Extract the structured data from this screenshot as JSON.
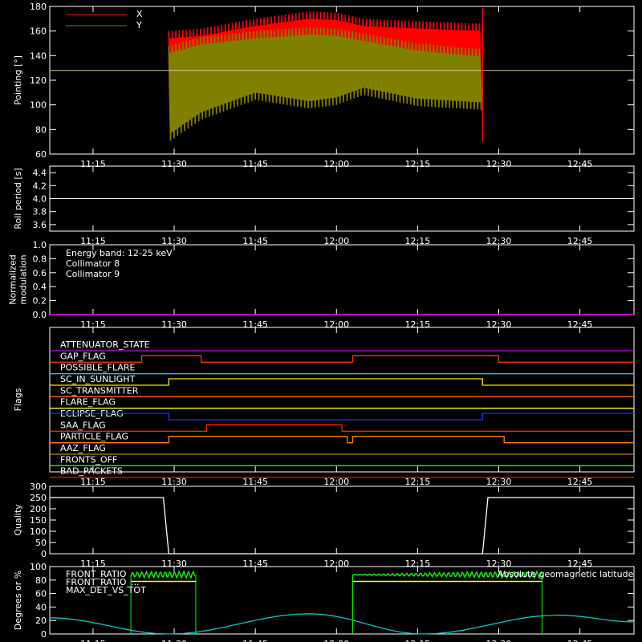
{
  "colors": {
    "background": "#000000",
    "frame": "#ffffff",
    "x_series": "#ff0000",
    "y_series": "#808000",
    "collimator8": "#00ffff",
    "collimator9": "#ff00ff",
    "front_ratio": "#ffff00",
    "front_ratio_2": "#00ff00",
    "max_det": "#ff8000",
    "geomag": "#00c8c8"
  },
  "time_axis": {
    "start": "11:07",
    "end": "12:55",
    "ticks": [
      "11:15",
      "11:30",
      "11:45",
      "12:00",
      "12:15",
      "12:30",
      "12:45"
    ]
  },
  "chart_data": [
    {
      "type": "area",
      "panel": "pointing",
      "ylabel": "Pointing [°]",
      "ylim": [
        60,
        180
      ],
      "yticks": [
        60,
        80,
        100,
        120,
        140,
        160,
        180
      ],
      "reference_line": 128,
      "legend": [
        {
          "name": "X",
          "color": "#ff0000"
        },
        {
          "name": "Y",
          "color": "#808000"
        }
      ],
      "data_start": "11:29",
      "data_end": "12:27",
      "series": [
        {
          "name": "X",
          "x": [
            "11:29",
            "11:35",
            "11:45",
            "11:55",
            "12:00",
            "12:05",
            "12:15",
            "12:27"
          ],
          "upper": [
            160,
            162,
            170,
            176,
            175,
            170,
            168,
            166
          ],
          "lower": [
            75,
            92,
            106,
            98,
            102,
            110,
            100,
            97
          ]
        },
        {
          "name": "Y",
          "x": [
            "11:29",
            "11:35",
            "11:45",
            "11:55",
            "12:00",
            "12:05",
            "12:15",
            "12:27"
          ],
          "upper": [
            148,
            155,
            160,
            163,
            162,
            158,
            150,
            145
          ],
          "lower": [
            70,
            88,
            104,
            97,
            100,
            108,
            99,
            96
          ]
        }
      ]
    },
    {
      "type": "line",
      "panel": "roll_period",
      "ylabel": "Roll period [s]",
      "ylim": [
        3.5,
        4.5
      ],
      "yticks": [
        3.6,
        3.8,
        4.0,
        4.2,
        4.4
      ],
      "value": 4.0
    },
    {
      "type": "line",
      "panel": "modulation",
      "ylabel_lines": [
        "Normalized",
        "modulation"
      ],
      "ylim": [
        0,
        1
      ],
      "yticks": [
        0.0,
        0.2,
        0.4,
        0.6,
        0.8,
        1.0
      ],
      "annotations": [
        {
          "text": "Energy band: 12-25 keV",
          "color": "#ffffff"
        },
        {
          "text": "Collimator 8",
          "color": "#00ffff"
        },
        {
          "text": "Collimator 9",
          "color": "#ff00ff"
        }
      ],
      "value": 0.0
    },
    {
      "type": "line",
      "panel": "flags",
      "ylabel": "Flags",
      "flags": [
        {
          "name": "ATTENUATOR_STATE",
          "color": "#c000ff",
          "segments": [
            [
              "11:07",
              "12:55",
              0
            ]
          ]
        },
        {
          "name": "GAP_FLAG",
          "color": "#ff3000",
          "segments": [
            [
              "11:07",
              "11:24",
              0
            ],
            [
              "11:24",
              "11:35",
              1
            ],
            [
              "11:35",
              "12:03",
              0
            ],
            [
              "12:03",
              "12:30",
              1
            ],
            [
              "12:30",
              "12:55",
              0
            ]
          ]
        },
        {
          "name": "POSSIBLE_FLARE",
          "color": "#00c8ff",
          "segments": [
            [
              "11:07",
              "12:55",
              0
            ]
          ]
        },
        {
          "name": "SC_IN_SUNLIGHT",
          "color": "#ffe000",
          "segments": [
            [
              "11:07",
              "11:29",
              0
            ],
            [
              "11:29",
              "12:27",
              1
            ],
            [
              "12:27",
              "12:55",
              0
            ]
          ]
        },
        {
          "name": "SC_TRANSMITTER",
          "color": "#ff6000",
          "segments": [
            [
              "11:07",
              "12:55",
              0
            ]
          ]
        },
        {
          "name": "FLARE_FLAG",
          "color": "#ffff00",
          "segments": [
            [
              "11:07",
              "12:55",
              0
            ]
          ]
        },
        {
          "name": "ECLIPSE_FLAG",
          "color": "#0040ff",
          "segments": [
            [
              "11:07",
              "11:29",
              1
            ],
            [
              "11:29",
              "12:27",
              0
            ],
            [
              "12:27",
              "12:55",
              1
            ]
          ]
        },
        {
          "name": "SAA_FLAG",
          "color": "#ff2000",
          "segments": [
            [
              "11:07",
              "11:36",
              0
            ],
            [
              "11:36",
              "12:01",
              1
            ],
            [
              "12:01",
              "12:55",
              0
            ]
          ]
        },
        {
          "name": "PARTICLE_FLAG",
          "color": "#ff8000",
          "segments": [
            [
              "11:07",
              "11:29",
              0
            ],
            [
              "11:29",
              "12:02",
              1
            ],
            [
              "12:02",
              "12:03",
              0
            ],
            [
              "12:03",
              "12:31",
              1
            ],
            [
              "12:31",
              "12:55",
              0
            ]
          ]
        },
        {
          "name": "AAZ_FLAG",
          "color": "#c08000",
          "segments": [
            [
              "11:07",
              "12:55",
              0
            ]
          ]
        },
        {
          "name": "FRONTS_OFF",
          "color": "#00ff00",
          "segments": [
            [
              "11:07",
              "12:55",
              0
            ]
          ]
        },
        {
          "name": "BAD_PACKETS",
          "color": "#ff0000",
          "segments": [
            [
              "11:07",
              "12:55",
              0
            ]
          ]
        }
      ]
    },
    {
      "type": "line",
      "panel": "quality",
      "ylabel": "Quality",
      "ylim": [
        0,
        300
      ],
      "yticks": [
        0,
        50,
        100,
        150,
        200,
        250,
        300
      ],
      "points": [
        [
          "11:07",
          250
        ],
        [
          "11:28",
          250
        ],
        [
          "11:29",
          0
        ],
        [
          "12:27",
          0
        ],
        [
          "12:28",
          250
        ],
        [
          "12:55",
          250
        ]
      ]
    },
    {
      "type": "line",
      "panel": "ratios",
      "ylabel": "Degrees or %",
      "ylim": [
        0,
        100
      ],
      "yticks": [
        0,
        20,
        40,
        60,
        80,
        100
      ],
      "legend": [
        {
          "name": "FRONT_RATIO",
          "color": "#ffff00"
        },
        {
          "name": "FRONT_RATIO_...",
          "color": "#00ff00"
        },
        {
          "name": "MAX_DET_VS_TOT",
          "color": "#ff8000"
        }
      ],
      "right_label": "Absolute geomagnetic latitude",
      "front_ratio_windows": [
        [
          "11:22",
          "11:34"
        ],
        [
          "12:03",
          "12:38"
        ]
      ],
      "front_ratio_value": 78,
      "front_ratio_2_value": 88,
      "geomag": {
        "x": [
          "11:07",
          "11:29",
          "11:55",
          "12:16",
          "12:41",
          "12:55"
        ],
        "y": [
          24,
          0,
          30,
          0,
          28,
          18
        ]
      }
    }
  ]
}
